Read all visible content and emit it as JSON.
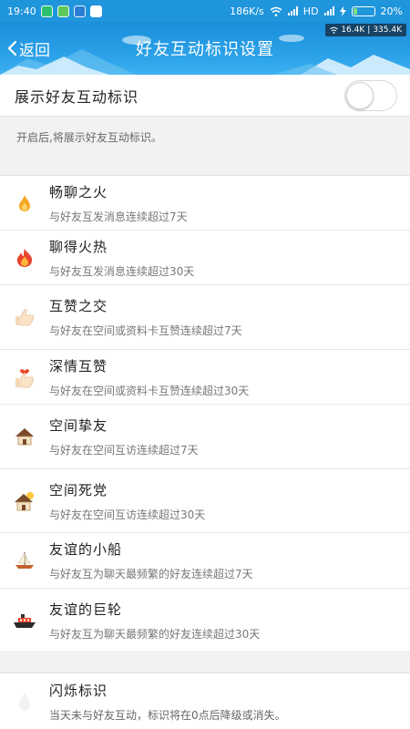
{
  "status_bar": {
    "time": "19:40",
    "net_speed": "186K/s",
    "network_type": "HD",
    "battery": "20%",
    "battery_level": 0.2
  },
  "speed_overlay": {
    "down": "16.4K",
    "up": "335.4K"
  },
  "header": {
    "back_label": "返回",
    "title": "好友互动标识设置"
  },
  "toggle": {
    "label": "展示好友互动标识",
    "enabled": false
  },
  "hint": "开启后,将展示好友互动标识。",
  "items": [
    {
      "name": "畅聊之火",
      "desc": "与好友互发消息连续超过7天",
      "icon": "small-flame-icon"
    },
    {
      "name": "聊得火热",
      "desc": "与好友互发消息连续超过30天",
      "icon": "big-flame-icon"
    },
    {
      "name": "互赞之交",
      "desc": "与好友在空间或资料卡互赞连续超过7天",
      "icon": "thumbs-up-icon"
    },
    {
      "name": "深情互赞",
      "desc": "与好友在空间或资料卡互赞连续超过30天",
      "icon": "thumbs-up-heart-icon"
    },
    {
      "name": "空间挚友",
      "desc": "与好友在空间互访连续超过7天",
      "icon": "house-icon"
    },
    {
      "name": "空间死党",
      "desc": "与好友在空间互访连续超过30天",
      "icon": "house-sun-icon"
    },
    {
      "name": "友谊的小船",
      "desc": "与好友互为聊天最频繁的好友连续超过7天",
      "icon": "sailboat-icon"
    },
    {
      "name": "友谊的巨轮",
      "desc": "与好友互为聊天最频繁的好友连续超过30天",
      "icon": "ship-icon"
    }
  ],
  "last_item": {
    "name": "闪烁标识",
    "desc": "当天未与好友互动，标识将在0点后降级或消失。"
  },
  "colors": {
    "header_blue": "#1f95dc",
    "flame": "#f5a623",
    "fire_red": "#e8452c"
  }
}
